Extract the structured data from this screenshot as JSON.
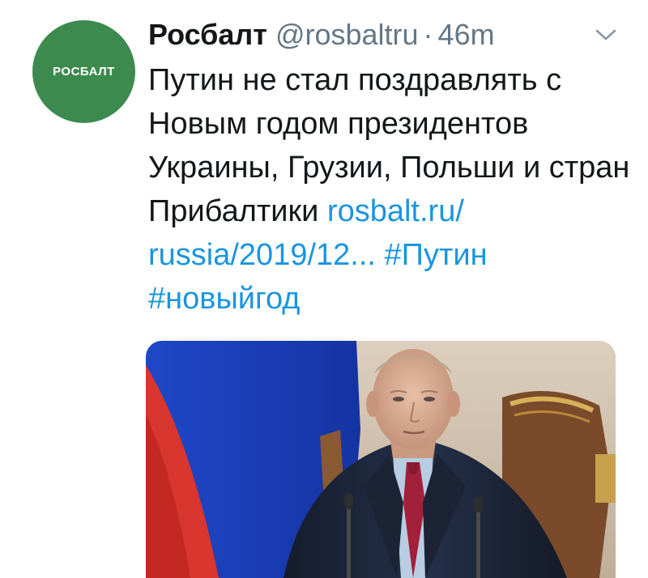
{
  "account": {
    "avatar_text": "РОСБАЛТ",
    "display_name": "Росбалт",
    "handle": "@rosbaltru",
    "separator": "·",
    "time": "46m"
  },
  "tweet": {
    "text": "Путин не стал поздравлять с Новым годом президентов Украины, Грузии, Польши и стран Прибалтики",
    "link_part1": "rosbalt.ru/",
    "link_part2": "russia/2019/12...",
    "hashtag1": "#Путин",
    "hashtag2": "#новыйгод"
  },
  "icons": {
    "menu": "chevron-down-icon"
  },
  "colors": {
    "avatar_bg": "#3d8a4f",
    "link": "#1b95e0",
    "muted": "#657786",
    "text": "#14171a"
  }
}
